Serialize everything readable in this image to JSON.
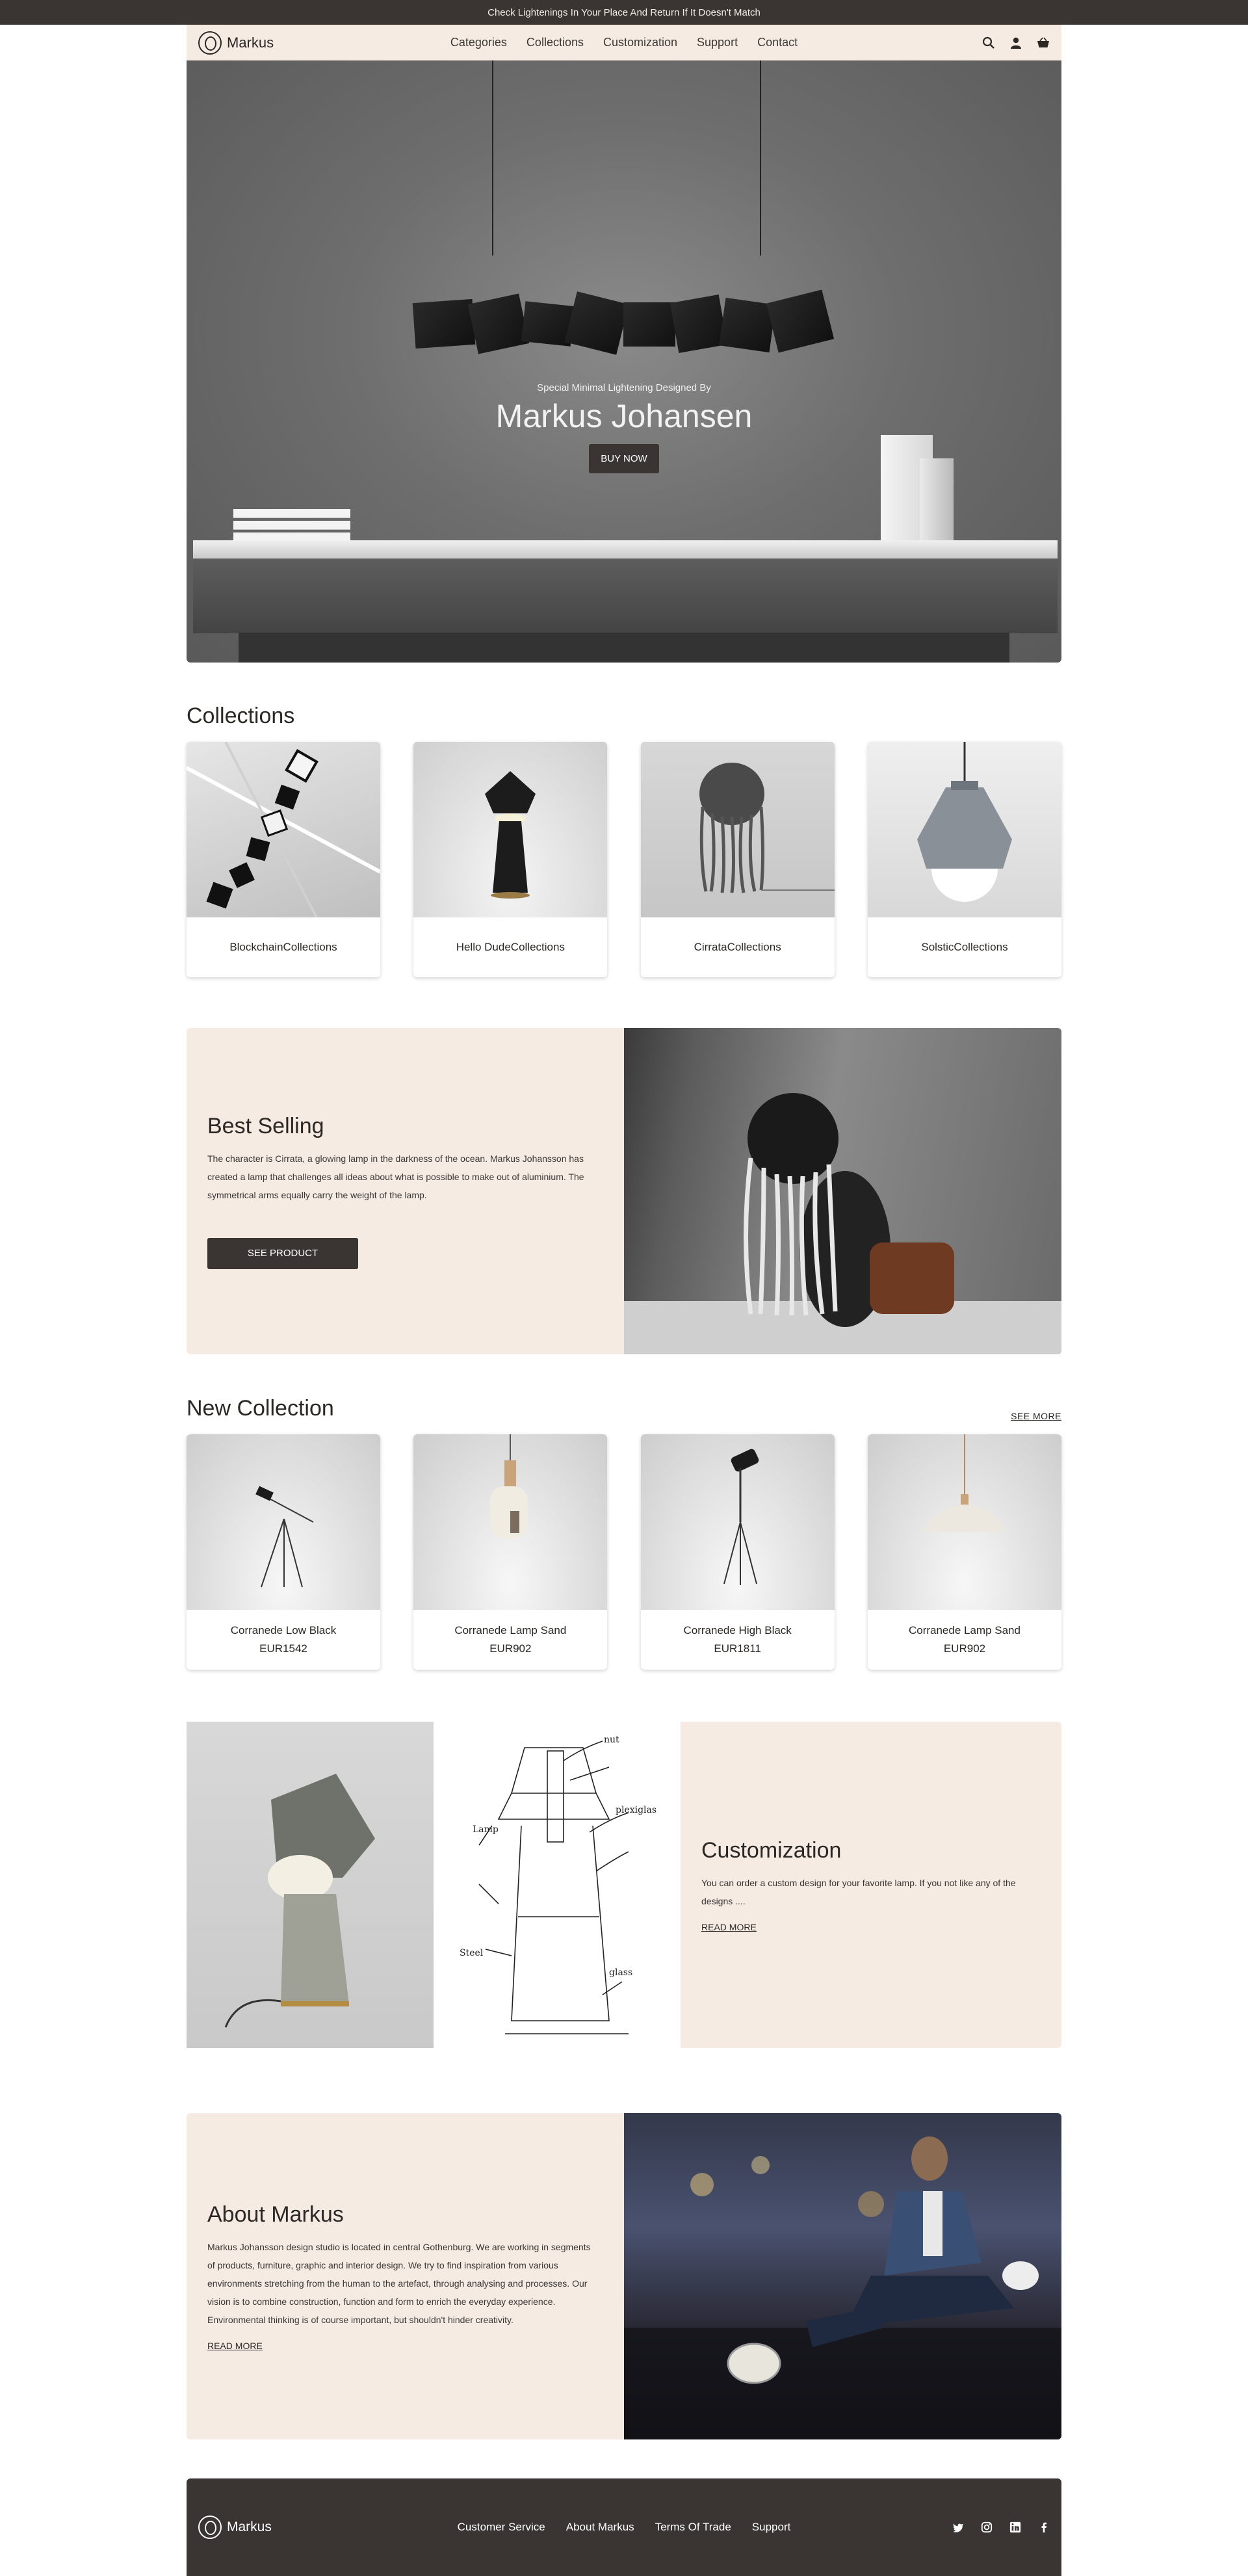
{
  "announcement": "Check Lightenings In Your Place And Return If It Doesn't Match",
  "brand": "Markus",
  "nav": {
    "items": [
      "Categories",
      "Collections",
      "Customization",
      "Support",
      "Contact"
    ],
    "icons": [
      "search-icon",
      "user-icon",
      "basket-icon"
    ]
  },
  "hero": {
    "subtitle": "Special Minimal Lightening Designed By",
    "title": "Markus Johansen",
    "button": "BUY NOW"
  },
  "collections": {
    "title": "Collections",
    "items": [
      {
        "label": "BlockchainCollections"
      },
      {
        "label": "Hello DudeCollections"
      },
      {
        "label": "CirrataCollections"
      },
      {
        "label": "SolsticCollections"
      }
    ]
  },
  "best_selling": {
    "title": "Best Selling",
    "body": "The character is Cirrata, a glowing lamp in the darkness of the ocean. Markus Johansson has created a lamp that challenges all ideas about what is possible to make out of aluminium. The symmetrical arms equally carry the weight of the lamp.",
    "button": "SEE PRODUCT"
  },
  "new_collection": {
    "title": "New Collection",
    "see_more": "SEE MORE",
    "items": [
      {
        "name": "Corranede Low Black",
        "price": "EUR1542"
      },
      {
        "name": "Corranede Lamp Sand",
        "price": "EUR902"
      },
      {
        "name": "Corranede High Black",
        "price": "EUR1811"
      },
      {
        "name": "Corranede Lamp Sand",
        "price": "EUR902"
      }
    ]
  },
  "customization": {
    "title": "Customization",
    "body": "You can order a custom design for your favorite lamp. If you not like any of the designs ....",
    "read_more": "READ MORE"
  },
  "about": {
    "title": "About Markus",
    "body": "Markus Johansson design studio is located in central Gothenburg. We are working in segments of products, furniture, graphic and interior design. We try to find inspiration from various environments stretching from the human to the artefact, through analysing and processes. Our vision is to combine construction, function and form to enrich the everyday experience. Environmental thinking is of course important, but shouldn't hinder creativity.",
    "read_more": "READ MORE"
  },
  "footer": {
    "brand": "Markus",
    "links": [
      "Customer Service",
      "About Markus",
      "Terms Of Trade",
      "Support"
    ],
    "social": [
      "twitter-icon",
      "instagram-icon",
      "linkedin-icon",
      "facebook-icon"
    ]
  },
  "colors": {
    "dark": "#3a3532",
    "beige": "#f5ebe3",
    "text": "#2b2724"
  }
}
